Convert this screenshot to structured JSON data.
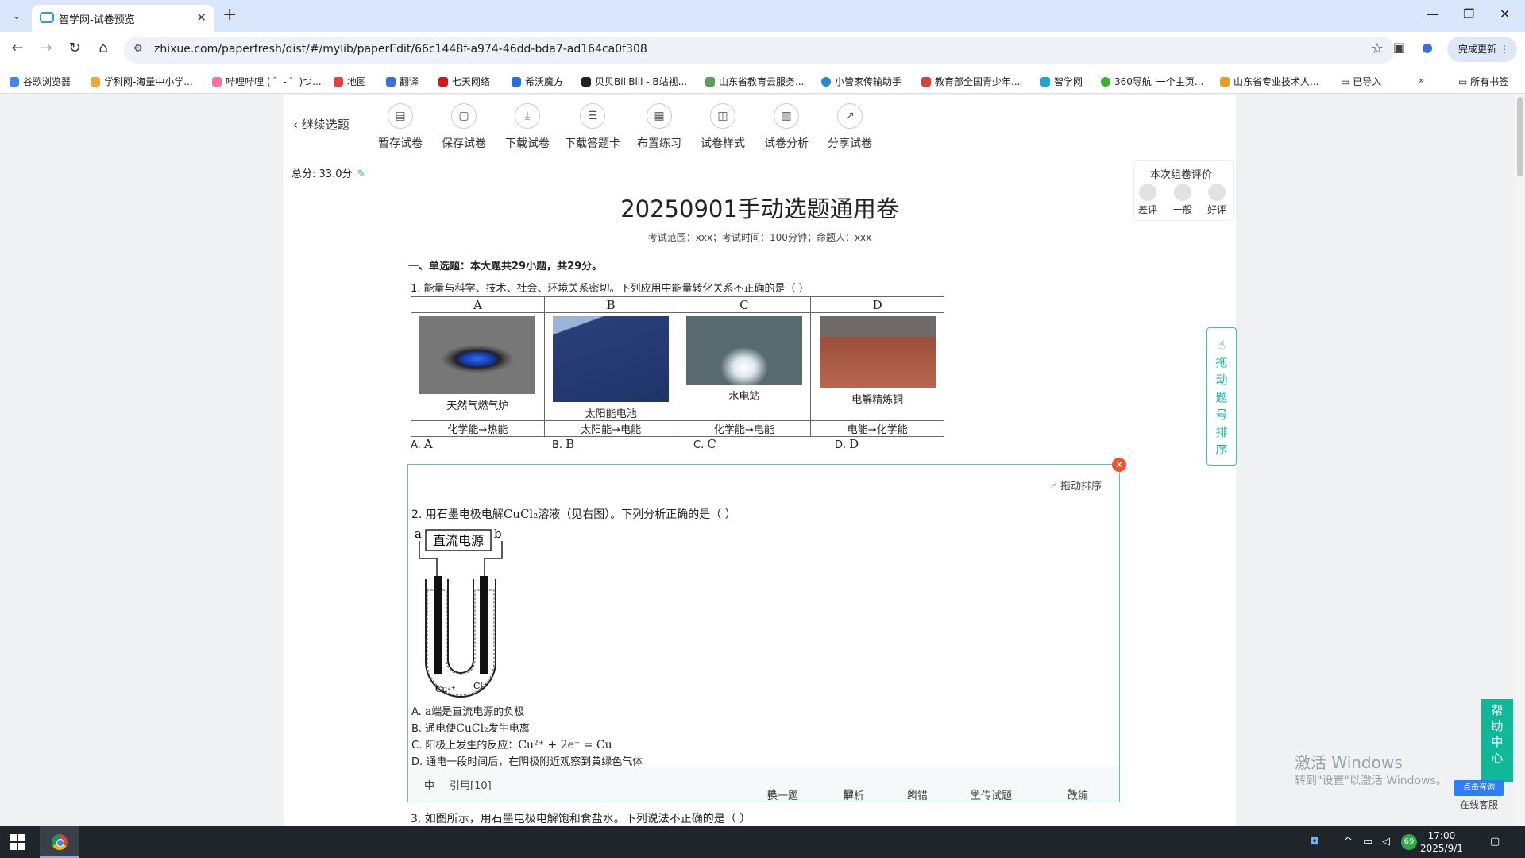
{
  "browser": {
    "tab_title": "智学网-试卷预览",
    "url": "zhixue.com/paperfresh/dist/#/mylib/paperEdit/66c1448f-a974-46dd-bda7-ad164ca0f308",
    "update_label": "完成更新",
    "bookmarks": [
      "谷歌浏览器",
      "学科网-海量中小学...",
      "哔哩哔哩 ( ゜- ゜)つ...",
      "地图",
      "翻译",
      "七天网络",
      "希沃魔方",
      "贝贝BiliBili - B站视...",
      "山东省教育云服务...",
      "小管家传输助手",
      "教育部全国青少年...",
      "智学网",
      "360导航_一个主页...",
      "山东省专业技术人...",
      "已导入"
    ],
    "all_bookmarks": "所有书签"
  },
  "toolbar": {
    "back_label": "继续选题",
    "items": [
      "暂存试卷",
      "保存试卷",
      "下载试卷",
      "下载答题卡",
      "布置练习",
      "试卷样式",
      "试卷分析",
      "分享试卷"
    ]
  },
  "score": {
    "label": "总分:",
    "value": "33.0分"
  },
  "rating": {
    "title": "本次组卷评价",
    "options": [
      "差评",
      "一般",
      "好评"
    ]
  },
  "paper": {
    "title": "20250901手动选题通用卷",
    "info": "考试范围：xxx；考试时间：100分钟；命题人：xxx",
    "section": "一、单选题：本大题共29小题，共29分。"
  },
  "q1": {
    "stem": "1. 能量与科学、技术、社会、环境关系密切。下列应用中能量转化关系不正确的是（    ）",
    "cols": [
      "A",
      "B",
      "C",
      "D"
    ],
    "captions": [
      "天然气燃气炉",
      "太阳能电池",
      "水电站",
      "电解精炼铜"
    ],
    "energy": [
      "化学能→热能",
      "太阳能→电能",
      "化学能→电能",
      "电能→化学能"
    ],
    "options": [
      {
        "k": "A.",
        "v": "A"
      },
      {
        "k": "B.",
        "v": "B"
      },
      {
        "k": "C.",
        "v": "C"
      },
      {
        "k": "D.",
        "v": "D"
      }
    ]
  },
  "q2": {
    "drag_label": "拖动排序",
    "stem_pre": "2. 用石墨电极电解",
    "stem_formula": "CuCl₂",
    "stem_post": "溶液（见右图）。下列分析正确的是（    ）",
    "diagram": {
      "power": "直流电源",
      "a": "a",
      "b": "b",
      "cu": "Cu²⁺",
      "cl": "Cl⁻"
    },
    "choices": [
      {
        "pre": "A. ",
        "formula": "a",
        "post": "端是直流电源的负极"
      },
      {
        "pre": "B. 通电使",
        "formula": "CuCl₂",
        "post": "发生电离"
      },
      {
        "pre": "C. 阳极上发生的反应：",
        "formula": "Cu²⁺ + 2e⁻ = Cu",
        "post": ""
      },
      {
        "pre": "D. 通电一段时间后，在阴极附近观察到黄绿色气体",
        "formula": "",
        "post": ""
      }
    ],
    "footer": {
      "difficulty": "中",
      "cite": "引用[10]",
      "swap": "换一题",
      "analysis": "解析",
      "correct": "纠错",
      "upload": "上传试题",
      "edit": "改编"
    }
  },
  "q3_stem": "3. 如图所示，用石墨电极电解饱和食盐水。下列说法不正确的是（    ）",
  "side": {
    "sort": [
      "拖",
      "动",
      "题",
      "号",
      "排",
      "序"
    ],
    "help": [
      "帮",
      "助",
      "中",
      "心"
    ],
    "consult": "点击咨询",
    "service": "在线客服"
  },
  "watermark": {
    "line1": "激活 Windows",
    "line2": "转到\"设置\"以激活 Windows。"
  },
  "taskbar": {
    "time": "17:00",
    "date": "2025/9/1",
    "badge": "69"
  }
}
